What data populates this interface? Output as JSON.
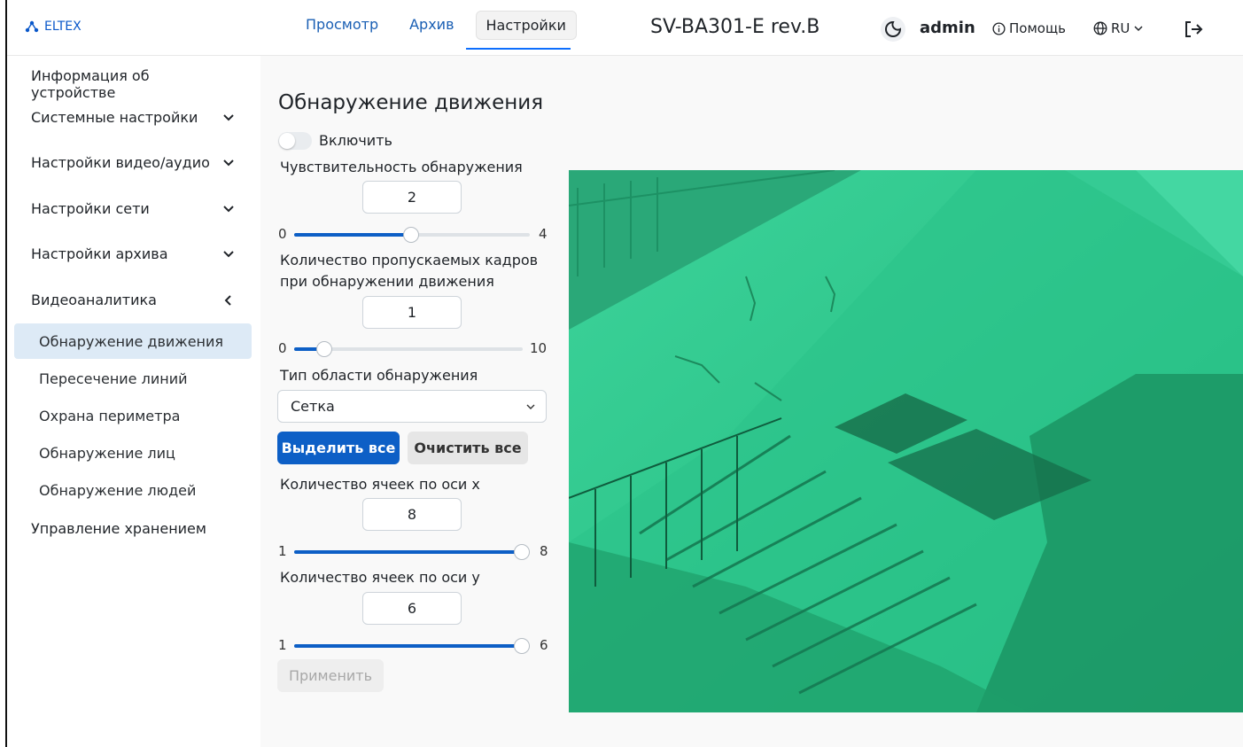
{
  "header": {
    "logo_text": "ELTEX",
    "tabs": [
      "Просмотр",
      "Архив",
      "Настройки"
    ],
    "active_tab": "Настройки",
    "device_title": "SV-BA301-E rev.B",
    "user": "admin",
    "help": "Помощь",
    "lang": "RU"
  },
  "sidebar": {
    "items": [
      {
        "label": "Информация об устройстве"
      },
      {
        "label": "Системные настройки"
      },
      {
        "label": "Настройки видео/аудио"
      },
      {
        "label": "Настройки сети"
      },
      {
        "label": "Настройки архива"
      },
      {
        "label": "Видеоаналитика"
      }
    ],
    "sub_items": [
      {
        "label": "Обнаружение движения",
        "active": true
      },
      {
        "label": "Пересечение линий"
      },
      {
        "label": "Охрана периметра"
      },
      {
        "label": "Обнаружение лиц"
      },
      {
        "label": "Обнаружение людей"
      }
    ],
    "last_item": "Управление хранением"
  },
  "main": {
    "title": "Обнаружение движения",
    "enable_label": "Включить",
    "enabled": false,
    "sensitivity": {
      "label": "Чувствительность обнаружения",
      "value": "2",
      "min": "0",
      "max": "4"
    },
    "skip_frames": {
      "label_1": "Количество пропускаемых кадров",
      "label_2": "при обнаружении движения",
      "value": "1",
      "min": "0",
      "max": "10"
    },
    "area_type": {
      "label": "Тип области обнаружения",
      "value": "Сетка"
    },
    "select_all": "Выделить все",
    "clear_all": "Очистить все",
    "cells_x": {
      "label": "Количество ячеек по оси x",
      "value": "8",
      "min": "1",
      "max": "8"
    },
    "cells_y": {
      "label": "Количество ячеек по оси y",
      "value": "6",
      "min": "1",
      "max": "6"
    },
    "apply": "Применить"
  },
  "colors": {
    "accent": "#0d5fc6",
    "overlay": "#1fd68c"
  }
}
